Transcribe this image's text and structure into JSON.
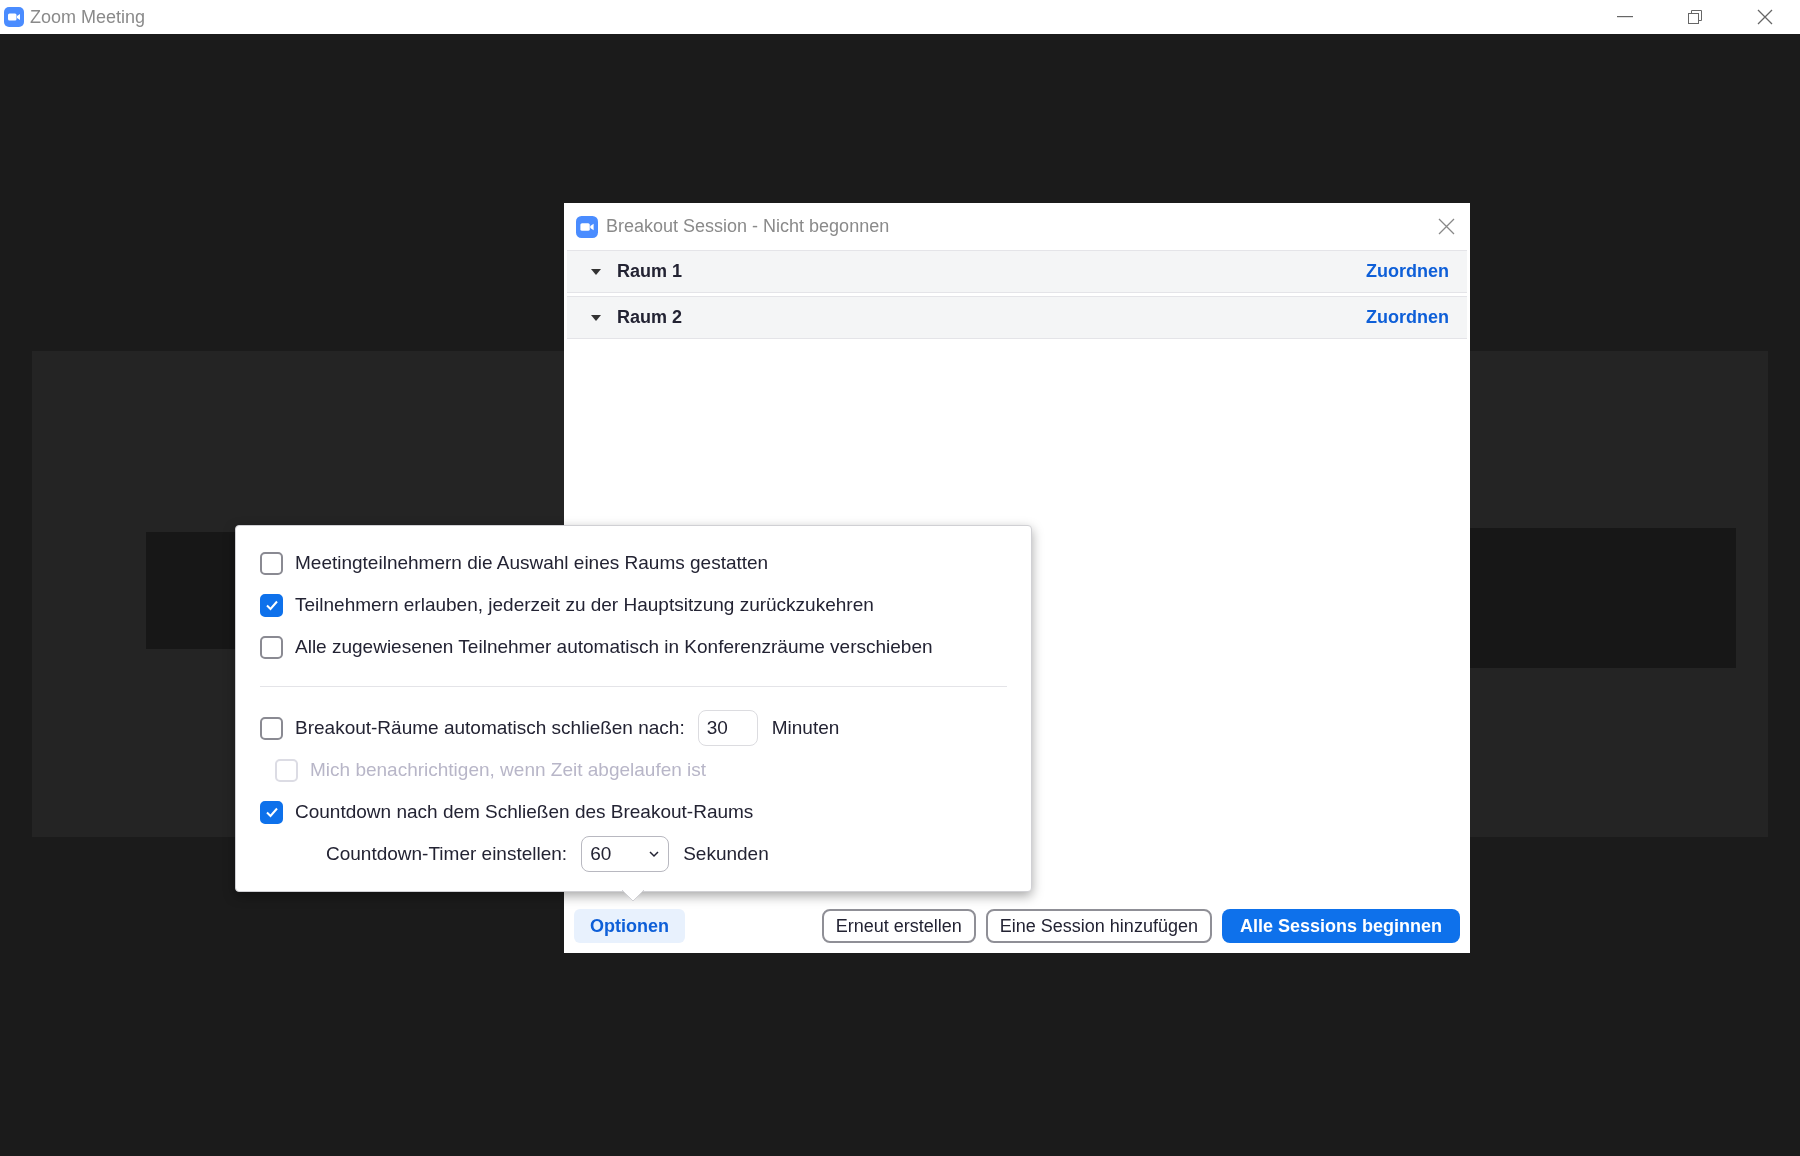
{
  "window": {
    "title": "Zoom Meeting"
  },
  "dialog": {
    "title": "Breakout Session - Nicht begonnen",
    "rooms": [
      {
        "name": "Raum 1",
        "expanded": true,
        "action": "Zuordnen"
      },
      {
        "name": "Raum 2",
        "expanded": true,
        "action": "Zuordnen"
      }
    ],
    "buttons": [
      {
        "label": "Optionen",
        "kind": "tab",
        "selected": true
      },
      {
        "label": "Erneut erstellen",
        "kind": "outline"
      },
      {
        "label": "Eine Session hinzufügen",
        "kind": "outline"
      },
      {
        "label": "Alle Sessions beginnen",
        "kind": "primary"
      }
    ]
  },
  "options": {
    "groups": [
      {
        "items": [
          {
            "kind": "checkbox",
            "label": "Meetingteilnehmern die Auswahl eines Raums gestatten",
            "checked": false,
            "disabled": false
          },
          {
            "kind": "checkbox",
            "label": "Teilnehmern erlauben, jederzeit zu der Hauptsitzung zurückzukehren",
            "checked": true,
            "disabled": false
          },
          {
            "kind": "checkbox",
            "label": "Alle zugewiesenen Teilnehmer automatisch in Konferenzräume verschieben",
            "checked": false,
            "disabled": false
          }
        ]
      },
      {
        "items": [
          {
            "kind": "checkbox-field",
            "label": "Breakout-Räume automatisch schließen nach:",
            "checked": false,
            "disabled": false,
            "value": "30",
            "unit": "Minuten",
            "children": [
              {
                "kind": "checkbox",
                "label": "Mich benachrichtigen, wenn Zeit abgelaufen ist",
                "checked": false,
                "disabled": true
              }
            ]
          },
          {
            "kind": "checkbox",
            "label": "Countdown nach dem Schließen des Breakout-Raums",
            "checked": true,
            "disabled": false,
            "children": [
              {
                "kind": "select",
                "label": "Countdown-Timer einstellen:",
                "value": "60",
                "unit": "Sekunden"
              }
            ]
          }
        ]
      }
    ]
  }
}
